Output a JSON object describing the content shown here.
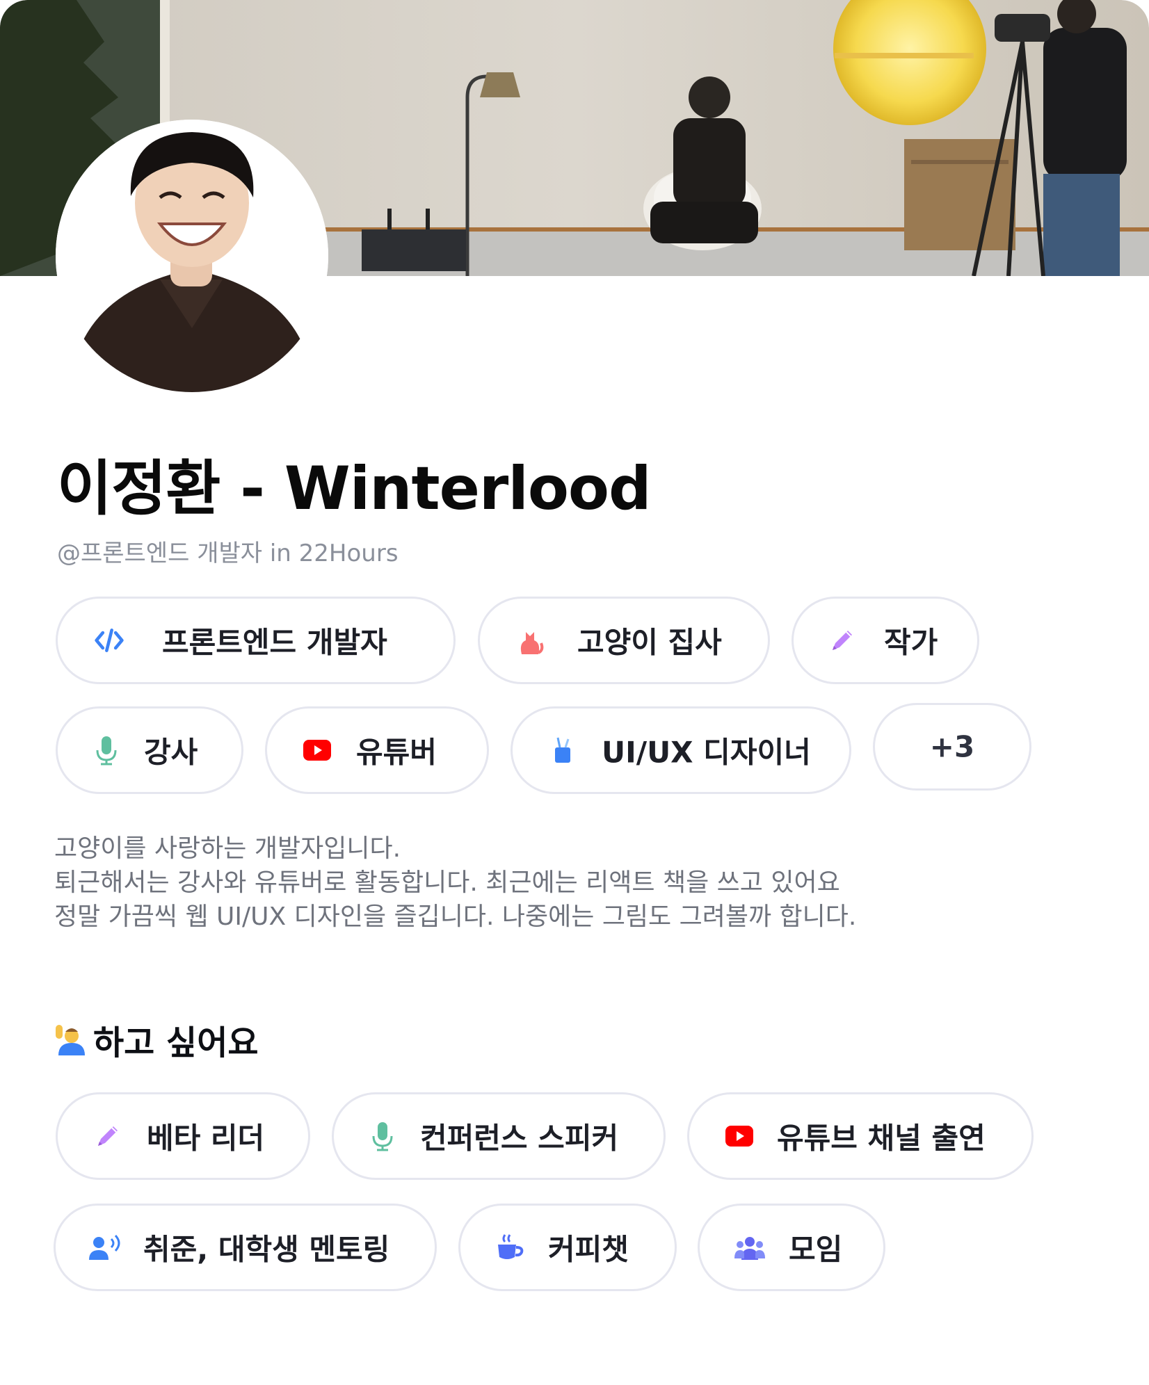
{
  "profile": {
    "name": "이정환 - Winterlood",
    "handle": "@프론트엔드 개발자 in 22Hours"
  },
  "roles": [
    {
      "label": "프론트엔드 개발자",
      "icon": "code-icon"
    },
    {
      "label": "고양이 집사",
      "icon": "cat-icon"
    },
    {
      "label": "작가",
      "icon": "pen-icon"
    },
    {
      "label": "강사",
      "icon": "microphone-icon"
    },
    {
      "label": "유튜버",
      "icon": "youtube-icon"
    },
    {
      "label": "UI/UX 디자이너",
      "icon": "brush-cup-icon"
    },
    {
      "label": "+3"
    }
  ],
  "bio": [
    "고양이를 사랑하는 개발자입니다.",
    "퇴근해서는 강사와 유튜버로 활동합니다. 최근에는 리액트 책을 쓰고 있어요",
    "정말 가끔씩 웹 UI/UX 디자인을 즐깁니다. 나중에는 그림도 그려볼까 합니다."
  ],
  "want": {
    "title": "하고 싶어요",
    "icon": "raising-hand-icon",
    "items": [
      {
        "label": "베타 리더",
        "icon": "pen-icon"
      },
      {
        "label": "컨퍼런스 스피커",
        "icon": "microphone-icon"
      },
      {
        "label": "유튜브 채널 출연",
        "icon": "youtube-icon"
      },
      {
        "label": "취준, 대학생 멘토링",
        "icon": "speaking-person-icon"
      },
      {
        "label": "커피챗",
        "icon": "coffee-icon"
      },
      {
        "label": "모임",
        "icon": "group-icon"
      }
    ]
  },
  "colors": {
    "code": "#3b82f6",
    "cat": "#f87171",
    "pen": "#c084fc",
    "mic": "#5fbf9f",
    "youtube": "#ff0000",
    "brush": "#3b82f6",
    "coffee": "#4f6ef7",
    "group": "#6366f1",
    "chip_border": "#e5e6ef"
  }
}
